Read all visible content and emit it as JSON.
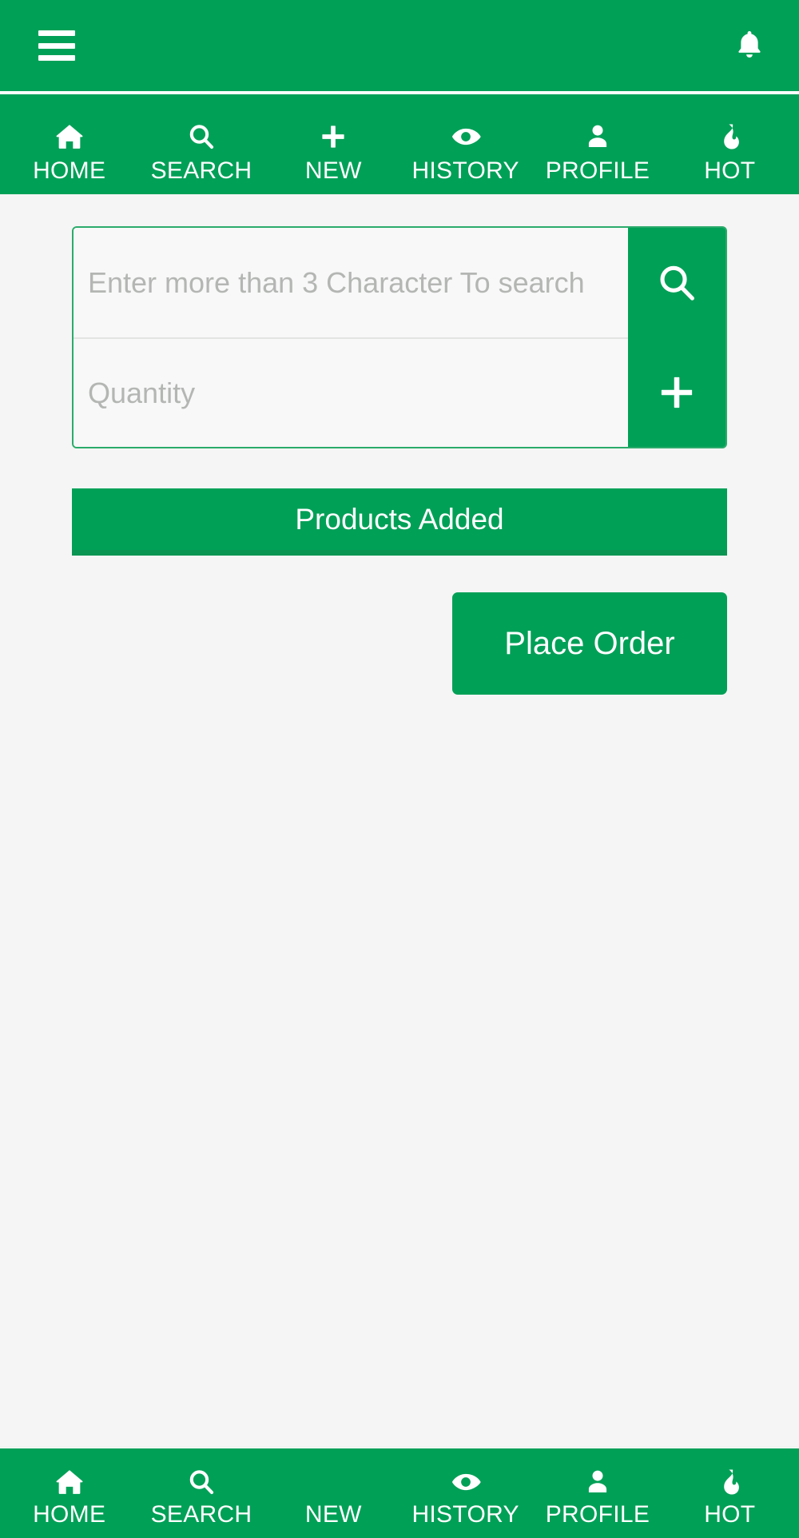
{
  "theme": {
    "brand_green": "#00a057",
    "bar_underline_green": "#0a9553",
    "page_background": "#f4f5f4",
    "field_background": "#f7f8f7",
    "placeholder_color": "#b4b6b4",
    "on_brand_text": "#ffffff"
  },
  "header": {
    "menu_icon": "hamburger-menu-icon",
    "notification_icon": "bell-icon"
  },
  "top_nav": {
    "items": [
      {
        "label": "HOME",
        "icon": "home-icon"
      },
      {
        "label": "SEARCH",
        "icon": "search-icon"
      },
      {
        "label": "NEW",
        "icon": "plus-icon"
      },
      {
        "label": "HISTORY",
        "icon": "eye-icon"
      },
      {
        "label": "PROFILE",
        "icon": "person-icon"
      },
      {
        "label": "HOT",
        "icon": "flame-icon"
      }
    ]
  },
  "bottom_nav": {
    "items": [
      {
        "label": "HOME",
        "icon": "home-icon"
      },
      {
        "label": "SEARCH",
        "icon": "search-icon"
      },
      {
        "label": "NEW",
        "icon": ""
      },
      {
        "label": "HISTORY",
        "icon": "eye-icon"
      },
      {
        "label": "PROFILE",
        "icon": "person-icon"
      },
      {
        "label": "HOT",
        "icon": "flame-icon"
      }
    ]
  },
  "main": {
    "product_search": {
      "placeholder": "Enter more than 3 Character To search",
      "value": "",
      "search_button_icon": "search-icon"
    },
    "quantity": {
      "placeholder": "Quantity",
      "value": "",
      "add_button_icon": "plus-icon"
    },
    "products_added_label": "Products Added",
    "place_order_label": "Place Order"
  }
}
